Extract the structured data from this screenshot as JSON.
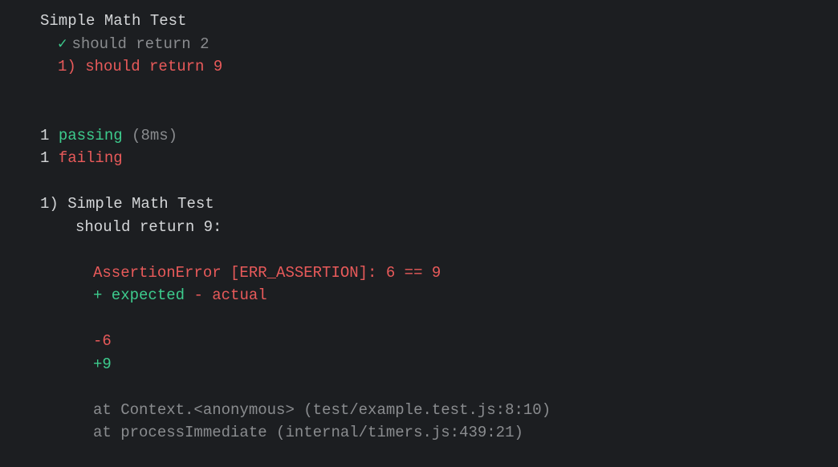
{
  "suite": {
    "title": "Simple Math Test",
    "tests": [
      {
        "status": "pass",
        "marker": "✓",
        "name": "should return 2"
      },
      {
        "status": "fail",
        "marker": "1)",
        "name": "should return 9"
      }
    ]
  },
  "summary": {
    "passing_count": "1",
    "passing_word": "passing",
    "duration": "(8ms)",
    "failing_count": "1",
    "failing_word": "failing"
  },
  "failure": {
    "index": "1)",
    "suite_name": "Simple Math Test",
    "test_name": "should return 9:",
    "assertion": "AssertionError [ERR_ASSERTION]: 6 == 9",
    "expected_label": "+ expected",
    "actual_label": "- actual",
    "diff_minus": "-6",
    "diff_plus": "+9",
    "stack": [
      "at Context.<anonymous> (test/example.test.js:8:10)",
      "at processImmediate (internal/timers.js:439:21)"
    ]
  }
}
